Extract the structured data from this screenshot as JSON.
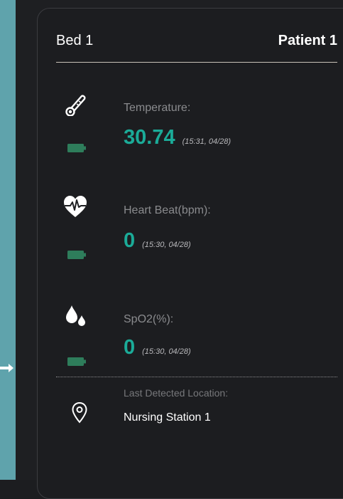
{
  "header": {
    "bed_label": "Bed 1",
    "patient_label": "Patient 1"
  },
  "metrics": [
    {
      "label": "Temperature:",
      "value": "30.74",
      "timestamp": "(15:31, 04/28)",
      "icon": "thermometer-icon"
    },
    {
      "label": "Heart Beat(bpm):",
      "value": "0",
      "timestamp": "(15:30, 04/28)",
      "icon": "heart-pulse-icon"
    },
    {
      "label": "SpO2(%):",
      "value": "0",
      "timestamp": "(15:30, 04/28)",
      "icon": "drops-icon"
    }
  ],
  "location": {
    "label": "Last Detected Location:",
    "value": "Nursing Station 1",
    "icon": "location-pin-icon"
  },
  "colors": {
    "accent": "#1bab98",
    "battery": "#2e7d5b",
    "background": "#1e1f22",
    "side_strip": "#5fa3ac"
  }
}
